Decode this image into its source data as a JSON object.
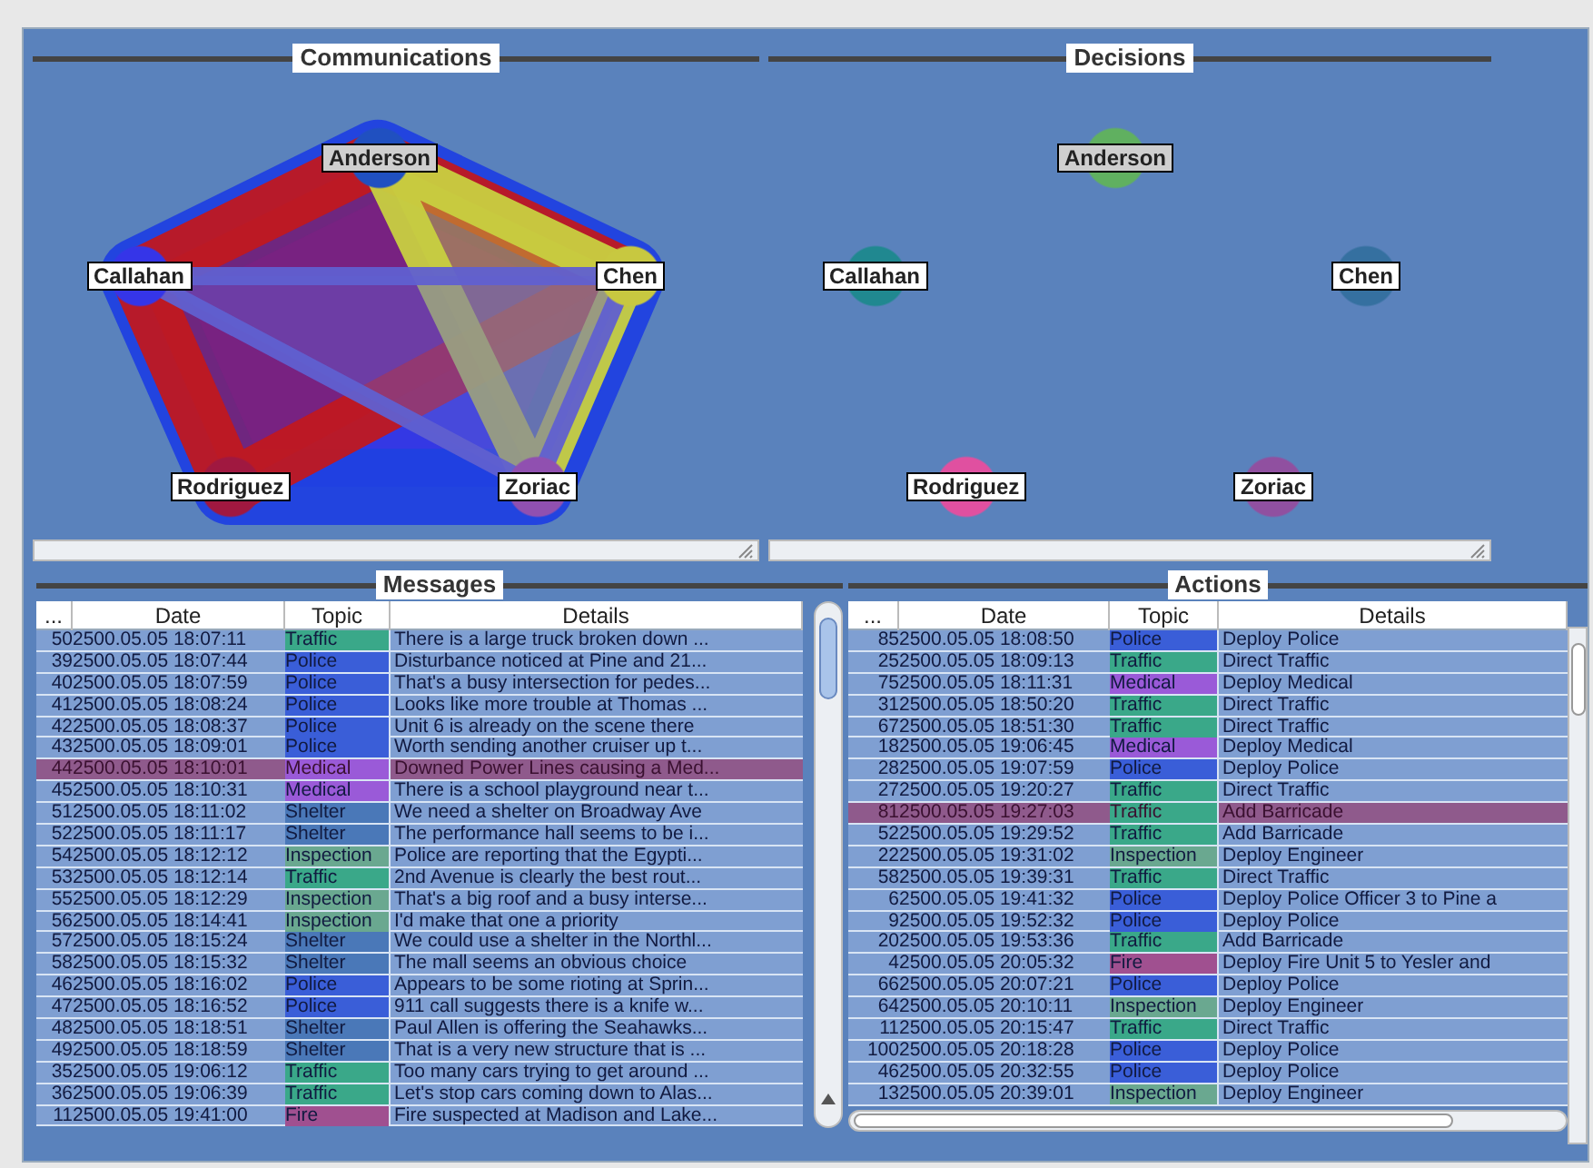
{
  "communications": {
    "title": "Communications",
    "nodes": [
      {
        "name": "Anderson",
        "color": "#2050c0"
      },
      {
        "name": "Callahan",
        "color": "#3535e8"
      },
      {
        "name": "Chen",
        "color": "#c8c840"
      },
      {
        "name": "Rodriguez",
        "color": "#a01840"
      },
      {
        "name": "Zoriac",
        "color": "#9050b0"
      }
    ]
  },
  "decisions": {
    "title": "Decisions",
    "nodes": [
      {
        "name": "Anderson",
        "color": "#60b060"
      },
      {
        "name": "Callahan",
        "color": "#208890"
      },
      {
        "name": "Chen",
        "color": "#3570a0"
      },
      {
        "name": "Rodriguez",
        "color": "#e050a0"
      },
      {
        "name": "Zoriac",
        "color": "#9050a0"
      }
    ]
  },
  "messages": {
    "title": "Messages",
    "columns": [
      "...",
      "Date",
      "Topic",
      "Details"
    ],
    "rows": [
      {
        "id": "50",
        "date": "2500.05.05 18:07:11",
        "topic": "Traffic",
        "color": "#3aa889",
        "details": "There is a large truck broken down ...",
        "selected": false
      },
      {
        "id": "39",
        "date": "2500.05.05 18:07:44",
        "topic": "Police",
        "color": "#3a5ed8",
        "details": "Disturbance noticed at Pine and 21...",
        "selected": false
      },
      {
        "id": "40",
        "date": "2500.05.05 18:07:59",
        "topic": "Police",
        "color": "#3a5ed8",
        "details": "That's a busy intersection for pedes...",
        "selected": false
      },
      {
        "id": "41",
        "date": "2500.05.05 18:08:24",
        "topic": "Police",
        "color": "#3a5ed8",
        "details": "Looks like more trouble at Thomas ...",
        "selected": false
      },
      {
        "id": "42",
        "date": "2500.05.05 18:08:37",
        "topic": "Police",
        "color": "#3a5ed8",
        "details": "Unit 6 is already on the scene there",
        "selected": false
      },
      {
        "id": "43",
        "date": "2500.05.05 18:09:01",
        "topic": "Police",
        "color": "#3a5ed8",
        "details": "Worth sending another cruiser up t...",
        "selected": false
      },
      {
        "id": "44",
        "date": "2500.05.05 18:10:01",
        "topic": "Medical",
        "color": "#9a5ad8",
        "details": "Downed Power Lines causing a Med...",
        "selected": true
      },
      {
        "id": "45",
        "date": "2500.05.05 18:10:31",
        "topic": "Medical",
        "color": "#9a5ad8",
        "details": "There is a school playground near t...",
        "selected": false
      },
      {
        "id": "51",
        "date": "2500.05.05 18:11:02",
        "topic": "Shelter",
        "color": "#4a78b8",
        "details": "We need a shelter on Broadway Ave",
        "selected": false
      },
      {
        "id": "52",
        "date": "2500.05.05 18:11:17",
        "topic": "Shelter",
        "color": "#4a78b8",
        "details": "The performance hall seems to be i...",
        "selected": false
      },
      {
        "id": "54",
        "date": "2500.05.05 18:12:12",
        "topic": "Inspection",
        "color": "#6aa890",
        "details": "Police are reporting that the Egypti...",
        "selected": false
      },
      {
        "id": "53",
        "date": "2500.05.05 18:12:14",
        "topic": "Traffic",
        "color": "#3aa889",
        "details": "2nd Avenue is clearly the best rout...",
        "selected": false
      },
      {
        "id": "55",
        "date": "2500.05.05 18:12:29",
        "topic": "Inspection",
        "color": "#6aa890",
        "details": "That's a big roof and a busy interse...",
        "selected": false
      },
      {
        "id": "56",
        "date": "2500.05.05 18:14:41",
        "topic": "Inspection",
        "color": "#6aa890",
        "details": "I'd make that one a priority",
        "selected": false
      },
      {
        "id": "57",
        "date": "2500.05.05 18:15:24",
        "topic": "Shelter",
        "color": "#4a78b8",
        "details": "We could use a shelter in the Northl...",
        "selected": false
      },
      {
        "id": "58",
        "date": "2500.05.05 18:15:32",
        "topic": "Shelter",
        "color": "#4a78b8",
        "details": "The mall seems an obvious choice",
        "selected": false
      },
      {
        "id": "46",
        "date": "2500.05.05 18:16:02",
        "topic": "Police",
        "color": "#3a5ed8",
        "details": "Appears to be some rioting at Sprin...",
        "selected": false
      },
      {
        "id": "47",
        "date": "2500.05.05 18:16:52",
        "topic": "Police",
        "color": "#3a5ed8",
        "details": "911 call suggests there is a knife w...",
        "selected": false
      },
      {
        "id": "48",
        "date": "2500.05.05 18:18:51",
        "topic": "Shelter",
        "color": "#4a78b8",
        "details": "Paul Allen is offering the Seahawks...",
        "selected": false
      },
      {
        "id": "49",
        "date": "2500.05.05 18:18:59",
        "topic": "Shelter",
        "color": "#4a78b8",
        "details": "That is a very new structure that is ...",
        "selected": false
      },
      {
        "id": "35",
        "date": "2500.05.05 19:06:12",
        "topic": "Traffic",
        "color": "#3aa889",
        "details": "Too many cars trying to get around ...",
        "selected": false
      },
      {
        "id": "36",
        "date": "2500.05.05 19:06:39",
        "topic": "Traffic",
        "color": "#3aa889",
        "details": "Let's stop cars coming down to Alas...",
        "selected": false
      },
      {
        "id": "11",
        "date": "2500.05.05 19:41:00",
        "topic": "Fire",
        "color": "#a05090",
        "details": "Fire suspected at Madison and Lake...",
        "selected": false
      }
    ]
  },
  "actions": {
    "title": "Actions",
    "columns": [
      "...",
      "Date",
      "Topic",
      "Details"
    ],
    "rows": [
      {
        "id": "85",
        "date": "2500.05.05 18:08:50",
        "topic": "Police",
        "color": "#3a5ed8",
        "details": "Deploy Police",
        "selected": false
      },
      {
        "id": "25",
        "date": "2500.05.05 18:09:13",
        "topic": "Traffic",
        "color": "#3aa889",
        "details": "Direct Traffic",
        "selected": false
      },
      {
        "id": "75",
        "date": "2500.05.05 18:11:31",
        "topic": "Medical",
        "color": "#9a5ad8",
        "details": "Deploy Medical",
        "selected": false
      },
      {
        "id": "31",
        "date": "2500.05.05 18:50:20",
        "topic": "Traffic",
        "color": "#3aa889",
        "details": "Direct Traffic",
        "selected": false
      },
      {
        "id": "67",
        "date": "2500.05.05 18:51:30",
        "topic": "Traffic",
        "color": "#3aa889",
        "details": "Direct Traffic",
        "selected": false
      },
      {
        "id": "18",
        "date": "2500.05.05 19:06:45",
        "topic": "Medical",
        "color": "#9a5ad8",
        "details": "Deploy Medical",
        "selected": false
      },
      {
        "id": "28",
        "date": "2500.05.05 19:07:59",
        "topic": "Police",
        "color": "#3a5ed8",
        "details": "Deploy Police",
        "selected": false
      },
      {
        "id": "27",
        "date": "2500.05.05 19:20:27",
        "topic": "Traffic",
        "color": "#3aa889",
        "details": "Direct Traffic",
        "selected": false
      },
      {
        "id": "81",
        "date": "2500.05.05 19:27:03",
        "topic": "Traffic",
        "color": "#3aa889",
        "details": "Add Barricade",
        "selected": true
      },
      {
        "id": "52",
        "date": "2500.05.05 19:29:52",
        "topic": "Traffic",
        "color": "#3aa889",
        "details": "Add Barricade",
        "selected": false
      },
      {
        "id": "22",
        "date": "2500.05.05 19:31:02",
        "topic": "Inspection",
        "color": "#6aa890",
        "details": "Deploy Engineer",
        "selected": false
      },
      {
        "id": "58",
        "date": "2500.05.05 19:39:31",
        "topic": "Traffic",
        "color": "#3aa889",
        "details": "Direct Traffic",
        "selected": false
      },
      {
        "id": "6",
        "date": "2500.05.05 19:41:32",
        "topic": "Police",
        "color": "#3a5ed8",
        "details": "Deploy Police Officer 3 to Pine a",
        "selected": false
      },
      {
        "id": "9",
        "date": "2500.05.05 19:52:32",
        "topic": "Police",
        "color": "#3a5ed8",
        "details": "Deploy Police",
        "selected": false
      },
      {
        "id": "20",
        "date": "2500.05.05 19:53:36",
        "topic": "Traffic",
        "color": "#3aa889",
        "details": "Add Barricade",
        "selected": false
      },
      {
        "id": "4",
        "date": "2500.05.05 20:05:32",
        "topic": "Fire",
        "color": "#a05090",
        "details": "Deploy Fire Unit 5 to Yesler and",
        "selected": false
      },
      {
        "id": "66",
        "date": "2500.05.05 20:07:21",
        "topic": "Police",
        "color": "#3a5ed8",
        "details": "Deploy Police",
        "selected": false
      },
      {
        "id": "64",
        "date": "2500.05.05 20:10:11",
        "topic": "Inspection",
        "color": "#6aa890",
        "details": "Deploy Engineer",
        "selected": false
      },
      {
        "id": "11",
        "date": "2500.05.05 20:15:47",
        "topic": "Traffic",
        "color": "#3aa889",
        "details": "Direct Traffic",
        "selected": false
      },
      {
        "id": "100",
        "date": "2500.05.05 20:18:28",
        "topic": "Police",
        "color": "#3a5ed8",
        "details": "Deploy Police",
        "selected": false
      },
      {
        "id": "46",
        "date": "2500.05.05 20:32:55",
        "topic": "Police",
        "color": "#3a5ed8",
        "details": "Deploy Police",
        "selected": false
      },
      {
        "id": "13",
        "date": "2500.05.05 20:39:01",
        "topic": "Inspection",
        "color": "#6aa890",
        "details": "Deploy Engineer",
        "selected": false
      }
    ]
  }
}
